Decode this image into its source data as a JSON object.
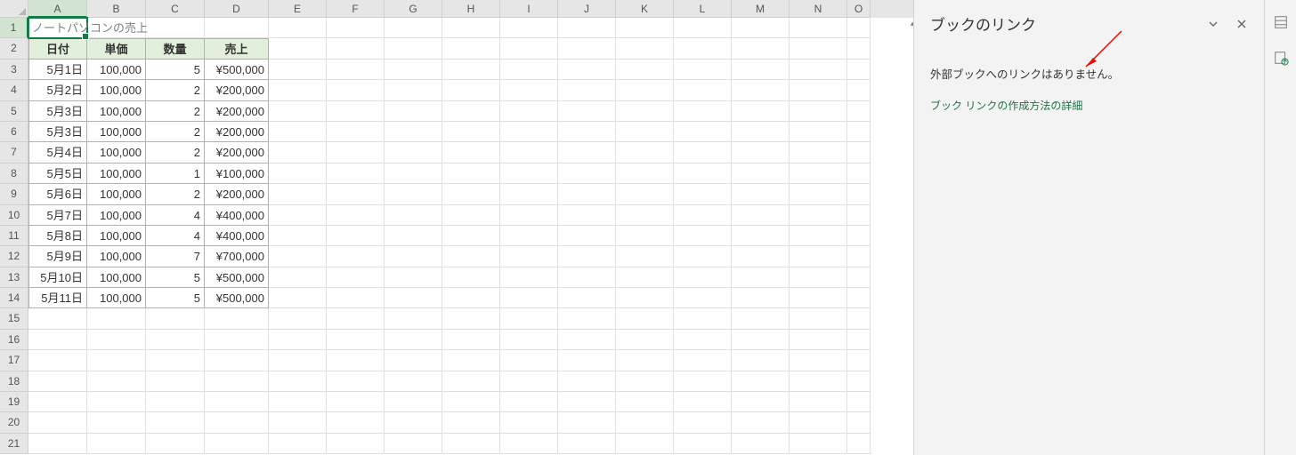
{
  "columns": [
    "A",
    "B",
    "C",
    "D",
    "E",
    "F",
    "G",
    "H",
    "I",
    "J",
    "K",
    "L",
    "M",
    "N",
    "O"
  ],
  "row_count": 21,
  "selected_cell": {
    "col": "A",
    "row": 1
  },
  "a1_overflow_text": "ノートパソコンの売上",
  "table": {
    "headers": [
      "日付",
      "単価",
      "数量",
      "売上"
    ],
    "rows": [
      {
        "date": "5月1日",
        "unit": "100,000",
        "qty": "5",
        "sales": "¥500,000"
      },
      {
        "date": "5月2日",
        "unit": "100,000",
        "qty": "2",
        "sales": "¥200,000"
      },
      {
        "date": "5月3日",
        "unit": "100,000",
        "qty": "2",
        "sales": "¥200,000"
      },
      {
        "date": "5月3日",
        "unit": "100,000",
        "qty": "2",
        "sales": "¥200,000"
      },
      {
        "date": "5月4日",
        "unit": "100,000",
        "qty": "2",
        "sales": "¥200,000"
      },
      {
        "date": "5月5日",
        "unit": "100,000",
        "qty": "1",
        "sales": "¥100,000"
      },
      {
        "date": "5月6日",
        "unit": "100,000",
        "qty": "2",
        "sales": "¥200,000"
      },
      {
        "date": "5月7日",
        "unit": "100,000",
        "qty": "4",
        "sales": "¥400,000"
      },
      {
        "date": "5月8日",
        "unit": "100,000",
        "qty": "4",
        "sales": "¥400,000"
      },
      {
        "date": "5月9日",
        "unit": "100,000",
        "qty": "7",
        "sales": "¥700,000"
      },
      {
        "date": "5月10日",
        "unit": "100,000",
        "qty": "5",
        "sales": "¥500,000"
      },
      {
        "date": "5月11日",
        "unit": "100,000",
        "qty": "5",
        "sales": "¥500,000"
      }
    ]
  },
  "panel": {
    "title": "ブックのリンク",
    "message": "外部ブックへのリンクはありません。",
    "link_text": "ブック リンクの作成方法の詳細"
  }
}
